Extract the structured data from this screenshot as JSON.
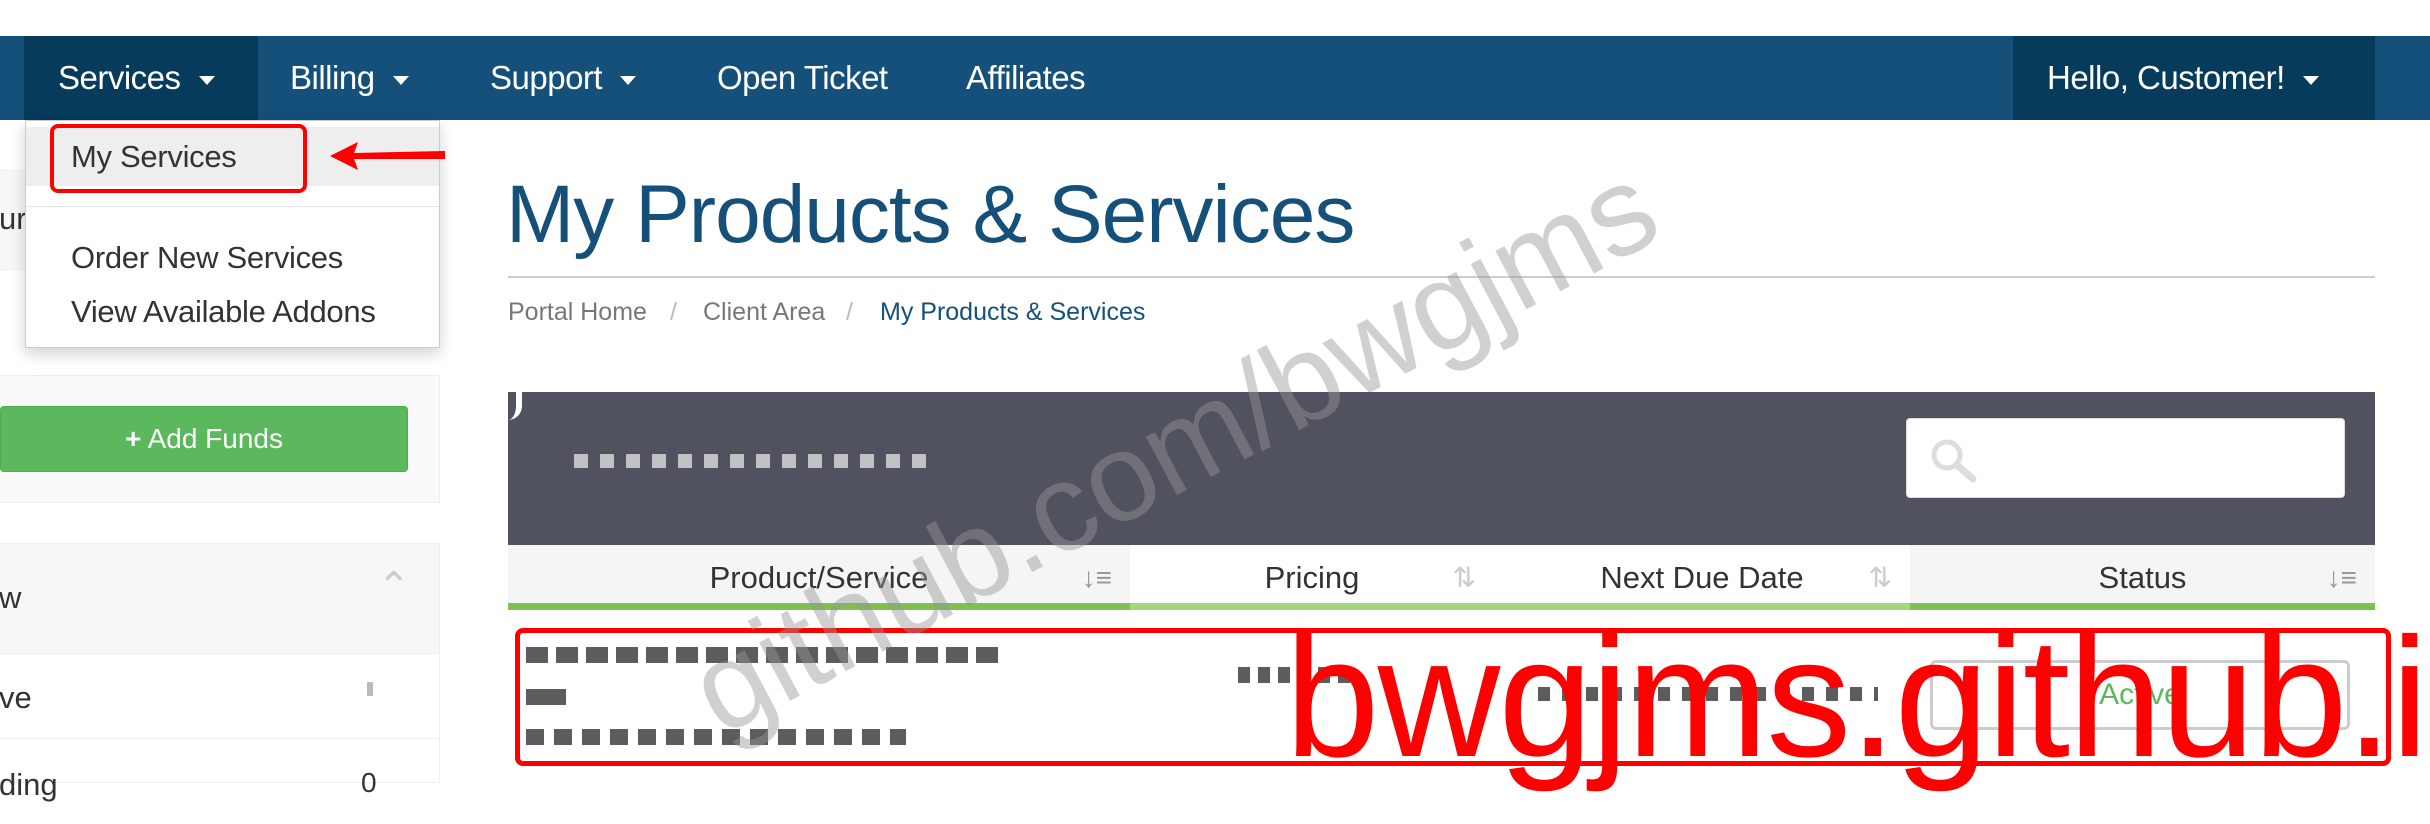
{
  "nav": {
    "items": [
      {
        "label": "Services",
        "dropdown": true
      },
      {
        "label": "Billing",
        "dropdown": true
      },
      {
        "label": "Support",
        "dropdown": true
      },
      {
        "label": "Open Ticket"
      },
      {
        "label": "Affiliates"
      }
    ],
    "user": "Hello, Customer!"
  },
  "services_menu": {
    "items": [
      "My Services",
      "Order New Services",
      "View Available Addons"
    ]
  },
  "sidebar": {
    "panel1_partial": "ur",
    "add_funds": "Add Funds",
    "panel2_header_partial": "w",
    "rows": [
      {
        "label": "ve",
        "count": ""
      },
      {
        "label": "ding",
        "count": "0"
      }
    ]
  },
  "page": {
    "title": "My Products & Services",
    "breadcrumb": [
      "Portal Home",
      "Client Area",
      "My Products & Services"
    ]
  },
  "table": {
    "columns": [
      "Product/Service",
      "Pricing",
      "Next Due Date",
      "Status"
    ],
    "row_status": "Active"
  },
  "watermarks": {
    "gray": "github.com/bwgjms",
    "red": "bwgjms.github.io"
  },
  "colors": {
    "nav": "#14507a",
    "nav_active": "#063b5c",
    "title": "#14507a",
    "add_funds": "#5cb85c",
    "table_header": "#50525f",
    "annotation": "#ff0000",
    "status_active": "#5cb85c"
  }
}
